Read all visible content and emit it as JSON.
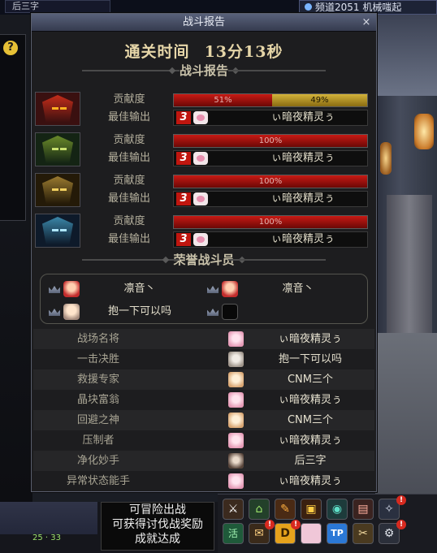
{
  "background": {
    "top_tab": "后三字",
    "channel": "频道2051 机械嗤起",
    "help": "?"
  },
  "dialog": {
    "title": "战斗报告",
    "close": "×",
    "clear_time_label": "通关时间",
    "clear_time_value": "13分13秒",
    "report_section": "战斗报告",
    "contribution_label": "贡献度",
    "best_output_label": "最佳输出",
    "players": [
      {
        "portrait": "red-mask",
        "segments": [
          {
            "text": "51%",
            "share": 0.51,
            "color": "red"
          },
          {
            "text": "49%",
            "share": 0.49,
            "color": "gold"
          }
        ],
        "skill": "3",
        "best": "ぃ暗夜精灵ぅ"
      },
      {
        "portrait": "green-mask",
        "segments": [
          {
            "text": "100%",
            "share": 1.0,
            "color": "red"
          }
        ],
        "skill": "3",
        "best": "ぃ暗夜精灵ぅ"
      },
      {
        "portrait": "gold-mask",
        "segments": [
          {
            "text": "100%",
            "share": 1.0,
            "color": "red"
          }
        ],
        "skill": "3",
        "best": "ぃ暗夜精灵ぅ"
      },
      {
        "portrait": "blue-mask",
        "segments": [
          {
            "text": "100%",
            "share": 1.0,
            "color": "red"
          }
        ],
        "skill": "3",
        "best": "ぃ暗夜精灵ぅ"
      }
    ],
    "honor_section": "荣誉战斗员",
    "honor": [
      {
        "name": "凛音丶",
        "avatar": "red"
      },
      {
        "name": "凛音丶",
        "avatar": "red"
      },
      {
        "name": "抱一下可以吗",
        "avatar": "tan"
      },
      {
        "name": "",
        "avatar": "empty"
      }
    ],
    "awards": [
      {
        "title": "战场名将",
        "name": "ぃ暗夜精灵ぅ",
        "avatar": "pink"
      },
      {
        "title": "一击决胜",
        "name": "抱一下可以吗",
        "avatar": "grey"
      },
      {
        "title": "救援专家",
        "name": "CNM三个",
        "avatar": "peach"
      },
      {
        "title": "晶块富翁",
        "name": "ぃ暗夜精灵ぅ",
        "avatar": "pink"
      },
      {
        "title": "回避之神",
        "name": "CNM三个",
        "avatar": "peach"
      },
      {
        "title": "压制者",
        "name": "ぃ暗夜精灵ぅ",
        "avatar": "pink"
      },
      {
        "title": "净化妙手",
        "name": "后三字",
        "avatar": "dark"
      },
      {
        "title": "异常状态能手",
        "name": "ぃ暗夜精灵ぅ",
        "avatar": "pink"
      }
    ]
  },
  "tooltip": {
    "line1": "可冒险出战",
    "line2": "可获得讨伐战奖励",
    "line3": "成就达成"
  },
  "hud": {
    "level_a": "25",
    "level_b": "33",
    "badge": "!",
    "tp_label": "TP",
    "d_label": "D",
    "checkin_label": "活"
  }
}
